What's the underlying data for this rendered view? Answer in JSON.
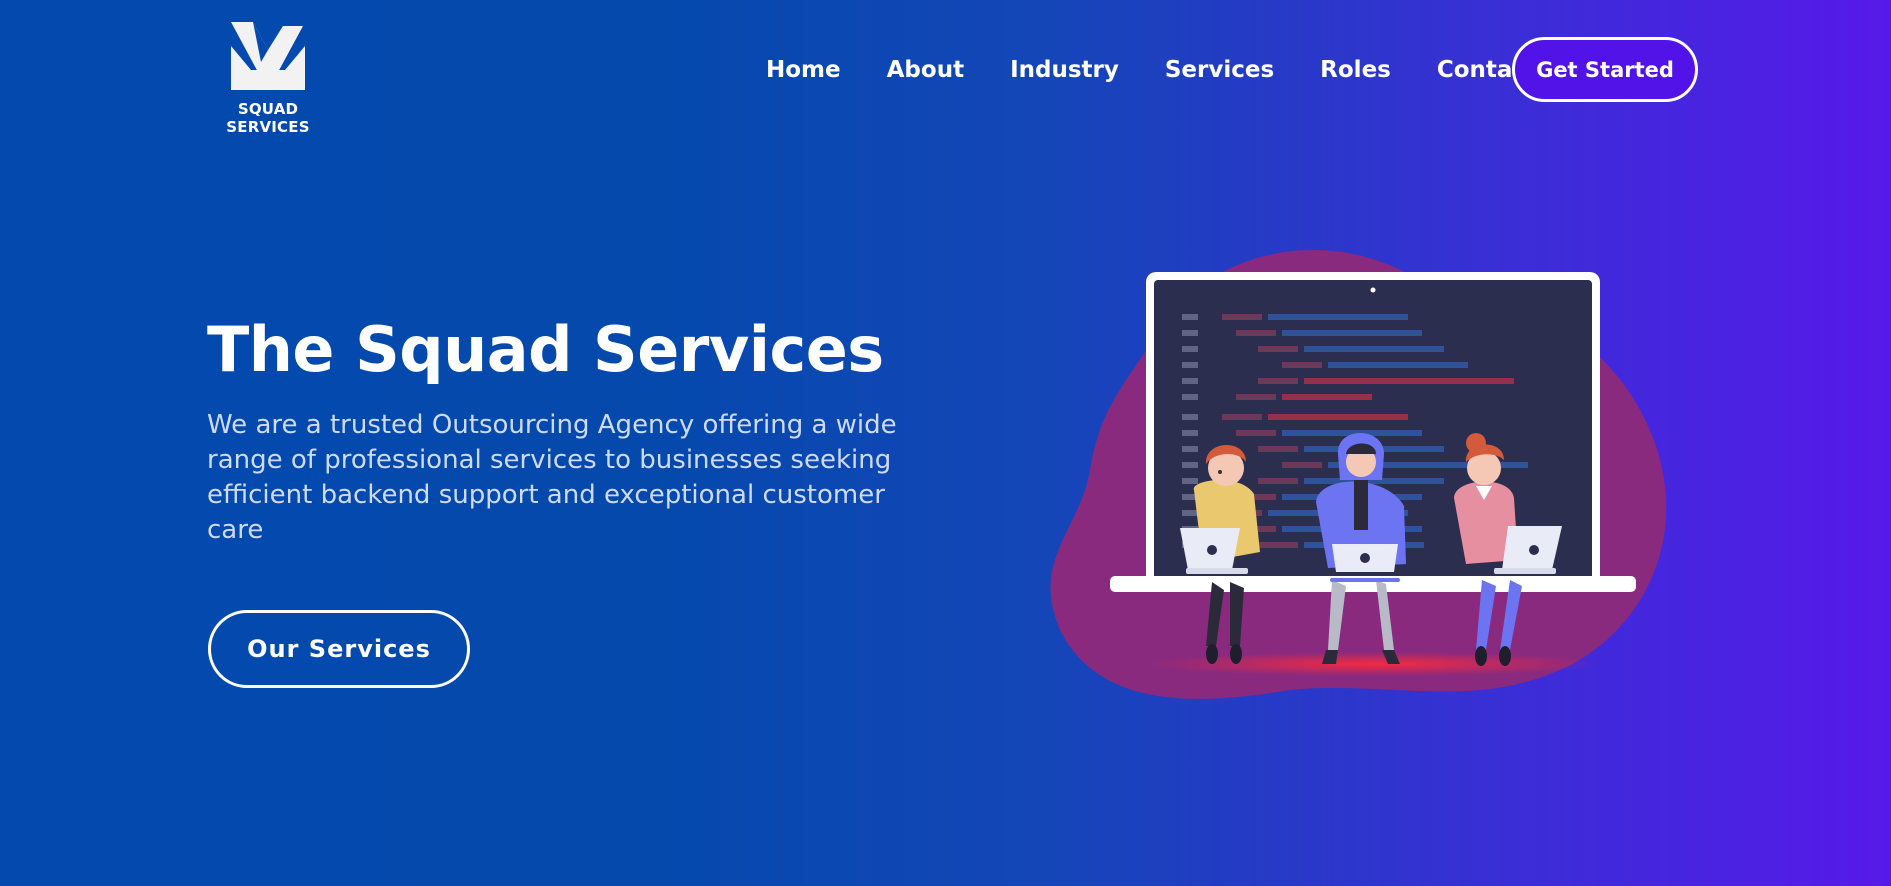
{
  "header": {
    "logo_text": "SQUAD SERVICES",
    "nav": [
      "Home",
      "About",
      "Industry",
      "Services",
      "Roles",
      "Contact"
    ],
    "cta_label": "Get Started"
  },
  "hero": {
    "title": "The Squad Services",
    "description": "We are a trusted Outsourcing Agency offering a wide range of professional services to businesses seeking efficient backend support and exceptional customer care",
    "button_label": "Our Services"
  },
  "colors": {
    "background_start": "#0449ad",
    "background_end": "#5719ea",
    "cta_background": "#5213e8",
    "blob": "#8a2a7e",
    "screen": "#2c2e4f"
  },
  "icons": [
    "logo-mark-icon",
    "team-laptops-illustration"
  ]
}
